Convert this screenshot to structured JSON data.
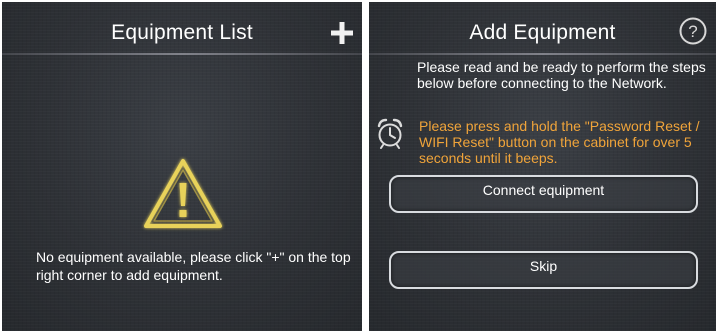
{
  "equipment_list": {
    "title": "Equipment List",
    "add_icon": "plus-icon",
    "warning_icon": "warning-triangle-icon",
    "empty_message": "No equipment available, please click \"+\" on the top right corner to add equipment."
  },
  "add_equipment": {
    "title": "Add Equipment",
    "help_icon": "question-circle-icon",
    "instructions": "Please read and be ready to perform the steps below before connecting to the Network.",
    "warning": "Please press and hold the \"Password Reset / WIFI Reset\" button on the cabinet for over 5 seconds until it beeps.",
    "alarm_icon": "alarm-clock-icon",
    "connect_label": "Connect equipment",
    "skip_label": "Skip"
  },
  "colors": {
    "background": "#2e3136",
    "text": "#ffffff",
    "warning_text": "#f0a43a",
    "warning_icon": "#e8d25a"
  }
}
